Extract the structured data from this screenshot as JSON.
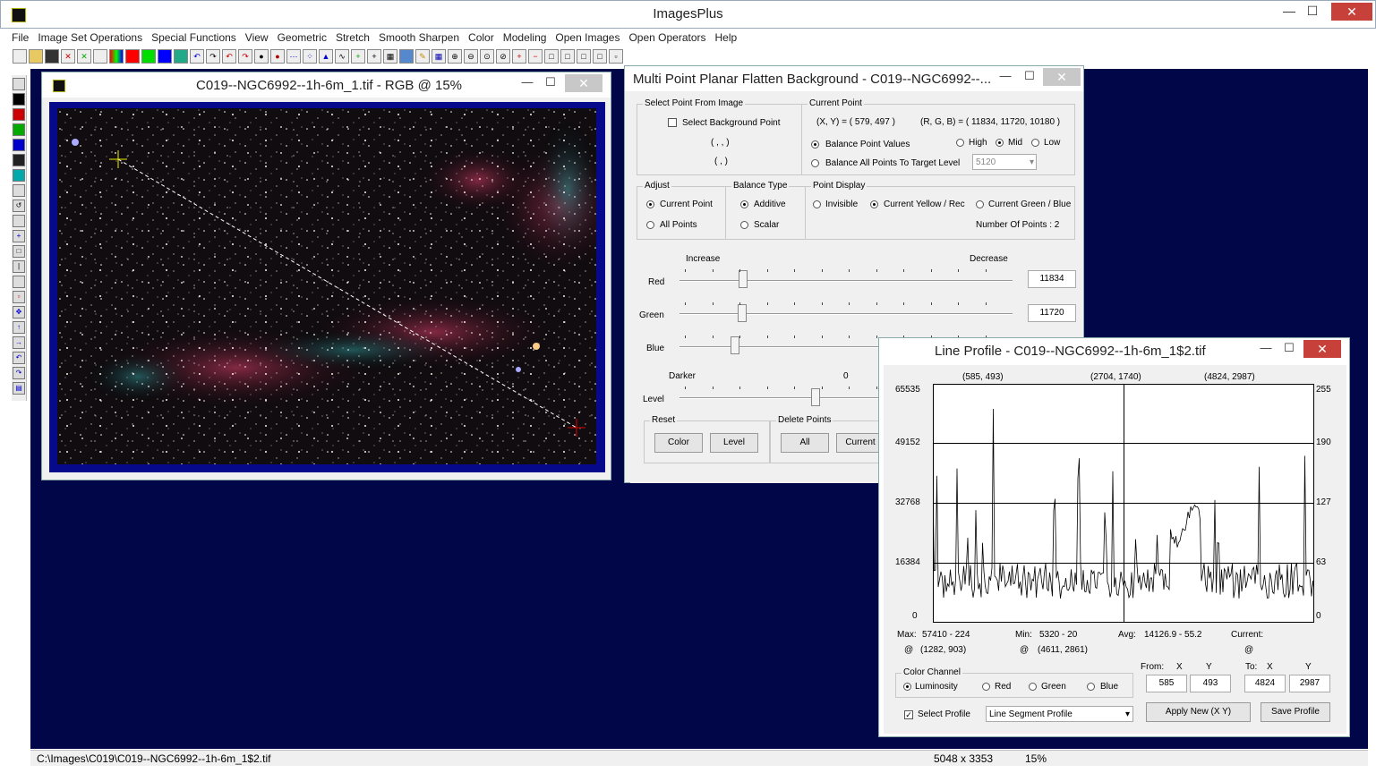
{
  "app": {
    "title": "ImagesPlus",
    "min": "—",
    "max": "☐",
    "close": "✕"
  },
  "menu": [
    "File",
    "Image Set Operations",
    "Special Functions",
    "View",
    "Geometric",
    "Stretch",
    "Smooth Sharpen",
    "Color",
    "Modeling",
    "Open Images",
    "Open Operators",
    "Help"
  ],
  "status": {
    "path": "C:\\Images\\C019\\C019--NGC6992--1h-6m_1$2.tif",
    "size": "5048 x 3353",
    "zoom": "15%"
  },
  "imgwin": {
    "title": "C019--NGC6992--1h-6m_1.tif - RGB @ 15%"
  },
  "mpp": {
    "title": "Multi Point Planar Flatten Background - C019--NGC6992--...",
    "select_group": "Select Point From Image",
    "select_bg": "Select Background Point",
    "coord1": "( , , )",
    "coord2": "( , )",
    "current_group": "Current Point",
    "xy": "(X, Y) = ( 579, 497 )",
    "rgb": "(R, G, B) = ( 11834, 11720, 10180 )",
    "balance_pv": "Balance Point Values",
    "high": "High",
    "mid": "Mid",
    "low": "Low",
    "balance_all": "Balance All Points To Target Level",
    "target": "5120",
    "adjust_group": "Adjust",
    "current_point": "Current Point",
    "all_points": "All Points",
    "btype_group": "Balance Type",
    "additive": "Additive",
    "scalar": "Scalar",
    "pd_group": "Point Display",
    "invisible": "Invisible",
    "cur_yr": "Current Yellow / Rec",
    "cur_gb": "Current Green / Blue",
    "num_points": "Number Of Points : 2",
    "increase": "Increase",
    "decrease": "Decrease",
    "red": "Red",
    "green": "Green",
    "blue": "Blue",
    "red_val": "11834",
    "green_val": "11720",
    "darker": "Darker",
    "zero": "0",
    "level": "Level",
    "reset_group": "Reset",
    "color_btn": "Color",
    "level_btn": "Level",
    "delete_group": "Delete Points",
    "all_btn": "All",
    "current_btn": "Current"
  },
  "lp": {
    "title": "Line Profile - C019--NGC6992--1h-6m_1$2.tif",
    "top_left": "(585, 493)",
    "top_mid": "(2704, 1740)",
    "top_right": "(4824, 2987)",
    "yleft": [
      "65535",
      "49152",
      "32768",
      "16384",
      "0"
    ],
    "yright": [
      "255",
      "190",
      "127",
      "63",
      "0"
    ],
    "max_lbl": "Max:",
    "max_val": "57410 - 224",
    "max_at": "(1282, 903)",
    "min_lbl": "Min:",
    "min_val": "5320 - 20",
    "min_at": "(4611, 2861)",
    "avg_lbl": "Avg:",
    "avg_val": "14126.9 - 55.2",
    "cur_lbl": "Current:",
    "at": "@",
    "cc_group": "Color Channel",
    "luminosity": "Luminosity",
    "red": "Red",
    "green": "Green",
    "blue": "Blue",
    "from": "From:",
    "to": "To:",
    "x": "X",
    "y": "Y",
    "from_x": "585",
    "from_y": "493",
    "to_x": "4824",
    "to_y": "2987",
    "select_profile": "Select Profile",
    "profile_type": "Line Segment Profile",
    "apply": "Apply New (X Y)",
    "save": "Save Profile"
  }
}
